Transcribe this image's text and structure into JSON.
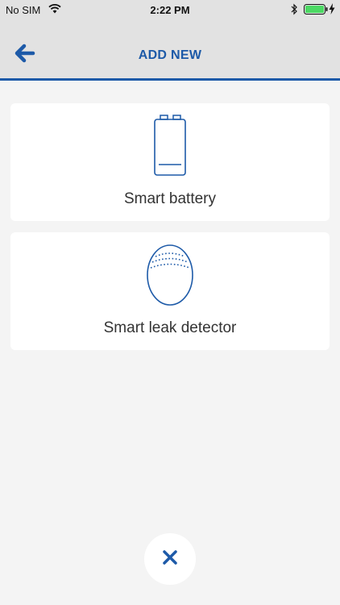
{
  "status_bar": {
    "carrier": "No SIM",
    "time": "2:22 PM",
    "icons": [
      "wifi-icon",
      "bluetooth-icon",
      "battery-icon",
      "charging-icon"
    ]
  },
  "header": {
    "title": "ADD NEW",
    "back_icon": "arrow-left-icon"
  },
  "devices": [
    {
      "label": "Smart battery",
      "icon": "battery-device-icon"
    },
    {
      "label": "Smart leak detector",
      "icon": "leak-detector-icon"
    }
  ],
  "close_icon": "close-icon",
  "colors": {
    "accent": "#1d5aa8",
    "header_bg": "#e2e2e2",
    "page_bg": "#f4f4f4",
    "card_bg": "#ffffff",
    "battery_green": "#4cd964"
  }
}
